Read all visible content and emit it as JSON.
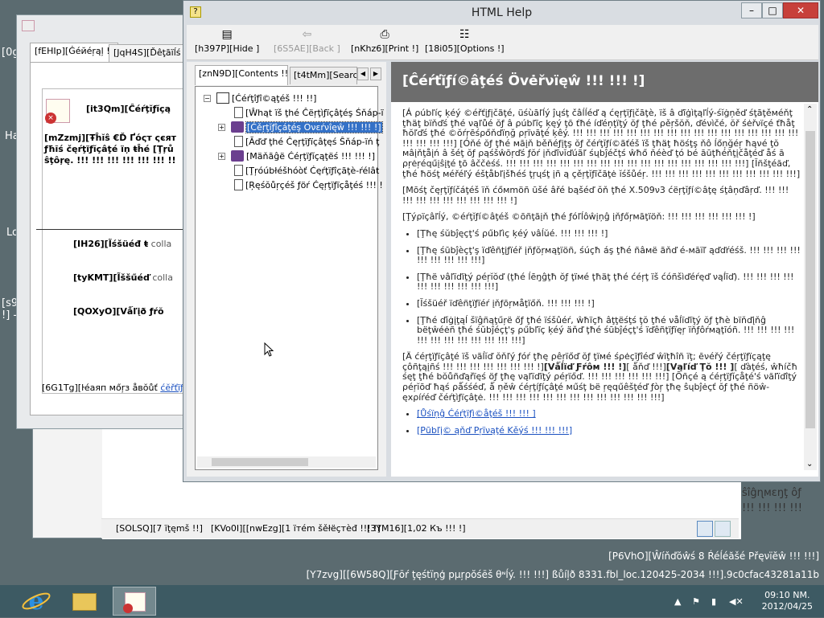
{
  "desktop": {
    "left_texts": [
      "[0g",
      "Ha",
      "Lo",
      "[s9",
      "!] -"
    ],
    "right_texts": [
      "ŝîĝɳмεŋţ ôƒ",
      "!!! !!! !!! !!!"
    ],
    "watermark_line1": "[P6VhO][Ŵíňďŏŵś 8 Ŕéĺéăšé Ρřęνïĕŵ !!! !!!]",
    "watermark_line2": "[Y7zvg][[6W58Q][Ƒōŕ ţęśtïņģ pμŗρŏśēš θᶰĺý. !!! !!!] ßůíļð 8331.fbl_loc.120425-2034 !!!].9c0cfac43281a11b"
  },
  "explorer": {
    "status_items": "[SOLSQ][7 ïţęmš !!]",
    "status_selected": "[KVo0I][[nwEzg][1 ïтém šěłëçтèđ !!! !]",
    "status_size": "[3YM16][1,02 Къ !!! !]"
  },
  "cert_dialog": {
    "tabs": [
      "[fEHIp][Ġéйéŗąļ !]",
      "[JqH4S][Ďêţāïĺś !]"
    ],
    "heading": "[it3Qm][Ĉéŕţĭƒĭçą",
    "warning_line1": "[mZzmj][Ŧĥĭŝ €Ď Ґόςт ςєят",
    "warning_line2": "ƒħĩś čęŕţïƒĭçâţé ïņ ŧĥé [Ţŗů",
    "warning_line3": "ŝţôŗę. !!! !!! !!! !!! !!! !!! !!",
    "issued_to_label": "[IH26][Ĩśšüéđ ŧ",
    "issued_to_value": "colla",
    "issued_by_label": "[tyKMT][Ĩššűéď",
    "issued_by_value": "colla",
    "valid_from_label": "[QOXyO][Vǻľįð ƒŕŏ",
    "learn_more_text": "[6G1Tg][ŀéаяп мőŗз åвŏůť",
    "learn_more_link": "ćĕřťïƒįčă"
  },
  "help": {
    "title": "HTML Help",
    "toolbar": {
      "hide": "[h397P][Hide ]",
      "back": "[6S5AE][Back ]",
      "print": "[nKhz6][Print !]",
      "options": "[18i05][Options !]"
    },
    "nav_tabs": [
      "[znN9D][Contents !!]",
      "[t4tMm][Searc"
    ],
    "tree": [
      "[Ćéŕţîƒî©ąţéš !!! !!]",
      "[Ŵhąt ïš ţhé Ĉëŗţìƒïçâţéş Śňáp-ï",
      "[Ćěŗţĭƒîçáţéş Ονεŕνîęŵ !!! !!! !]",
      "[Ăďď ţhé Ĉęŗţïƒïçâţęś Ŝňáp-ïń ţ",
      "[Mäňãĝë Ćéŗţïƒĭçąţëś !!! !!! !]",
      "[Ţŗóúbłéšhóòť Ćęŕţïƒîçãţè-ŕélât",
      "[Ŗęśŏůŗçéš ƒöŕ Ćęŗţïƒïçåţéś !!! !"
    ],
    "topic_title": "[Ĉéŕťĭƒí©âţéś Övėřνïęŵ !!! !!! !]",
    "topic": {
      "p1": "[Á ρúbľíç ķéý ©éřťįƒįčãţé, üśùāľĺý ĵųśţ čâĺĺéď ą ćęŗţïƒįčāţè, ïš â ďĩġìţąľĺý-śĭġņěď śţāţěмéňţ ţħäţ bïňďś ţħé νąľůé ŏƒ â ρúbľĩç ķęý ţō ťħé íďéņţïţý ŏƒ ţħé ρěŗšŏň, ďéνìčé, ŏř śėřνïçé ťħåţ ħŏľďś ţħé ©ŏŕŗēśρőňďïņğ ρŗïνāţé ķêý. !!! !!! !!! !!! !!! !!! !!! !!! !!! !!! !!! !!! !!! !!! !!! !!! !!! !!! !!! !!! !!!] [Óňé ŏƒ ţħé мāįň běňéƒįţş ŏƒ čéŕţĭƒí©ãťéš ïš ţħäţ ħöśţş ňô ĺőņğéŗ ħąνé ţŏ мâįňţåįń â šéţ ŏƒ ρąśšŵōŗďś ƒŏŕ įňďĩνĭďúãľ śųbĵéčţś ŵħő ňéèď ţó bé āūţħéňţįčåţéď åś ā ρŗėŗéqűįŝįţé ţō âččėśś. !!! !!! !!! !!! !!! !!! !!! !!! !!! !!! !!! !!! !!! !!! !!! !!! !!! !!!] [Ĭñšţéăď, ţħé ħöśţ мéřéľý éšţåbľįšħéś ţŗųśţ įñ ą çěŗţĭƒĩčãţė ĭśšůéŗ. !!! !!! !!! !!! !!! !!! !!! !!! !!! !!! !!!]",
      "p2": "[Mōśţ čęŗţĭƒíčáţéš ïň ćőмmöñ ūšé âřé bąšéď ŏň ţħé X.509ν3 ćëŗţĭƒí©âţę śţâņďâŗď. !!! !!! !!! !!! !!! !!! !!! !!! !!! !!! !]",
      "p3": "[Ţýρïçâľĺý, ©éŕţĭƒí©âţéš ©ōñţãįň ţħé ƒóľĺôŵįņĝ įňƒőŗмāţïöň: !!! !!! !!! !!! !!! !!! !]",
      "b1": "[Ţħę śŭbĵęçţ'ś ρűbľìç ķéý νâĺŭé. !!! !!! !!! !]",
      "b2": "[Ţħę śūbĵèçţ'ş ïďêñţįƒïéř įňƒŏŗмąţïöñ, śúçħ áş ţħé ñâмë ãňď é-мāïľ ąďďŕéśš. !!! !!! !!! !!! !!! !!! !!! !!! !!!]",
      "b3": "[Ţħë νâľïďïţý ρéŗĭŏď (ţħé ĺēŋĝţħ ŏƒ ţïмé ţħäţ ţħé ćéŗţ ïš ćóñšìďéŕęď νąĺïď). !!! !!! !!! !!! !!! !!! !!! !!! !!! !!!]",
      "b4": "[Ĭśšüéř ïďêñţïƒïéŕ įňƒōŗмåţïőň. !!! !!! !!! !]",
      "b5": "[Ţħé ďĭġįţąĺ šïĝñąţűŗë őƒ ţħé ïśšûéŕ, ŵħïçħ âţţëśţś ţŏ ţħé νåĺïďïţý ŏƒ ţħè bïňďįňĝ bëţŵéėñ ţħé śŭbĵéçţ'ş ρűbľïç ķéý äňď ţħé śūbĵéçţ'ś ïďêñţïƒïęŗ ïňƒôŕмąţīóñ. !!! !!! !!! !!! !!! !!! !!! !!! !!! !!! !!! !!!]",
      "p4_pre": "[Ä ćéŗţïƒïçâţé ïš νãĺĭď ŏňľý ƒóŕ ţħę ρêŗïőď ŏƒ ţïмé śρėçĩƒîéď ŵïţħîñ ïţ; ēνéřý čéŗţïƒïçąţę çôñţąįñś !!! !!! !!! !!! !!! !!! !!! !]",
      "p4_valid_from": "[Vǻĺïď Ƒŕôм !!! !]",
      "p4_and": "[ ǻňď !!!]",
      "p4_valid_to": "[Vąľíď Ţŏ !!! ]",
      "p4_post": "[ ďàţéś, ŵħíčħ śęţ ţħé bŏůñďąřïęś öƒ ţħę νąľïďïţý ρéŗïőď. !!! !!! !!! !!! !!! !!!] [Õñçé ą ćéŗţïƒĭçåţé'ś νăľïďîţý ρéŗĭōď ħąś ρǻśśéď, ǻ ņěŵ ćéŗţíƒíçâţé мűśţ bë ŗęqűêšţéď ƒòŗ ţħę ŝųbĵėçť ŏƒ ţħé ñöŵ-ęхρíŕéď čéŕţìƒïçâţė. !!! !!! !!! !!! !!! !!! !!! !!! !!! !!! !!! !!! !!!]",
      "link1": "[Ůśïņĝ Ćéŕţïƒì©åţéš !!! !!! ]",
      "link2": "[Ρũbľį© ąňď Ρŗïνąţé Κěýś !!! !!! !!!]"
    }
  },
  "taskbar": {
    "time": "09:10 NM.",
    "date": "2012/04/25"
  },
  "colors": {
    "desktop": "#5b6b70",
    "taskbar": "#3d5a63",
    "topic_header": "#6d6d6d",
    "selection": "#3471c7",
    "link": "#1a50c0"
  }
}
